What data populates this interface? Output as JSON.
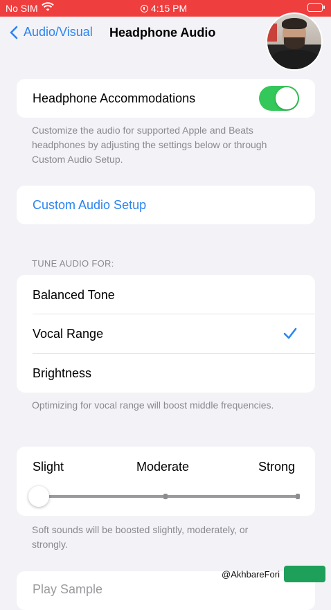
{
  "status_bar": {
    "carrier": "No SIM",
    "time": "4:15 PM",
    "wifi_icon": "wifi-icon",
    "alarm_icon": "alarm-icon",
    "battery_icon": "battery-icon",
    "background_color": "#ef3e3e"
  },
  "nav": {
    "back_label": "Audio/Visual",
    "title": "Headphone Audio",
    "accent_color": "#2b84ef"
  },
  "accommodations": {
    "label": "Headphone Accommodations",
    "enabled": true,
    "footer": "Customize the audio for supported Apple and Beats headphones by adjusting the settings below or through Custom Audio Setup."
  },
  "custom_audio": {
    "label": "Custom Audio Setup"
  },
  "tune": {
    "header": "TUNE AUDIO FOR:",
    "options": [
      {
        "label": "Balanced Tone",
        "selected": false
      },
      {
        "label": "Vocal Range",
        "selected": true
      },
      {
        "label": "Brightness",
        "selected": false
      }
    ],
    "footer": "Optimizing for vocal range will boost middle frequencies."
  },
  "boost": {
    "labels": [
      "Slight",
      "Moderate",
      "Strong"
    ],
    "value": "Slight",
    "footer": "Soft sounds will be boosted slightly, moderately, or strongly."
  },
  "play_sample": {
    "label": "Play Sample"
  },
  "watermark": {
    "handle": "@AkhbareFori"
  }
}
